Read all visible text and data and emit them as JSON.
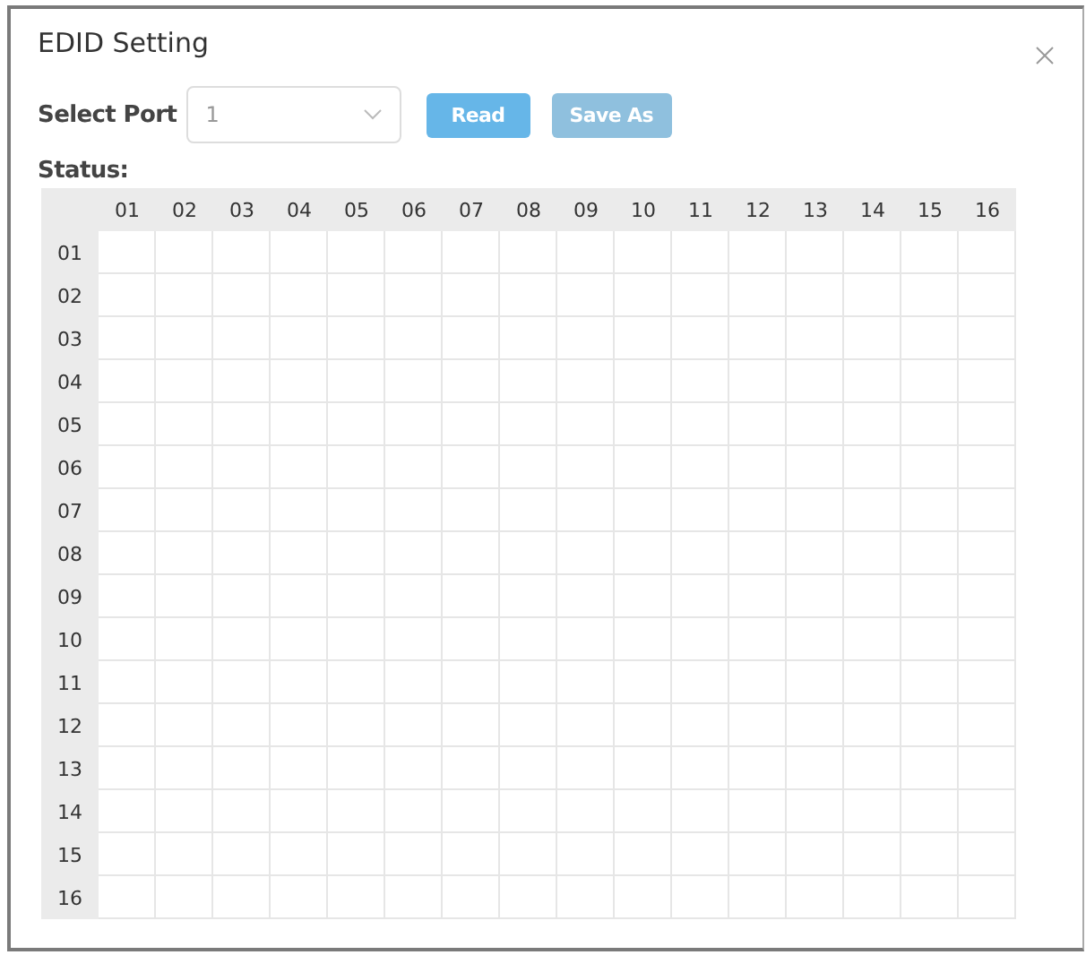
{
  "dialog": {
    "title": "EDID Setting"
  },
  "port": {
    "label": "Select Port",
    "value": "1"
  },
  "buttons": [
    {
      "label": "Read",
      "disabled": false
    },
    {
      "label": "Save As",
      "disabled": true
    }
  ],
  "status": {
    "label": "Status:"
  },
  "grid": {
    "columns": [
      "01",
      "02",
      "03",
      "04",
      "05",
      "06",
      "07",
      "08",
      "09",
      "10",
      "11",
      "12",
      "13",
      "14",
      "15",
      "16"
    ],
    "rows": [
      "01",
      "02",
      "03",
      "04",
      "05",
      "06",
      "07",
      "08",
      "09",
      "10",
      "11",
      "12",
      "13",
      "14",
      "15",
      "16"
    ]
  }
}
